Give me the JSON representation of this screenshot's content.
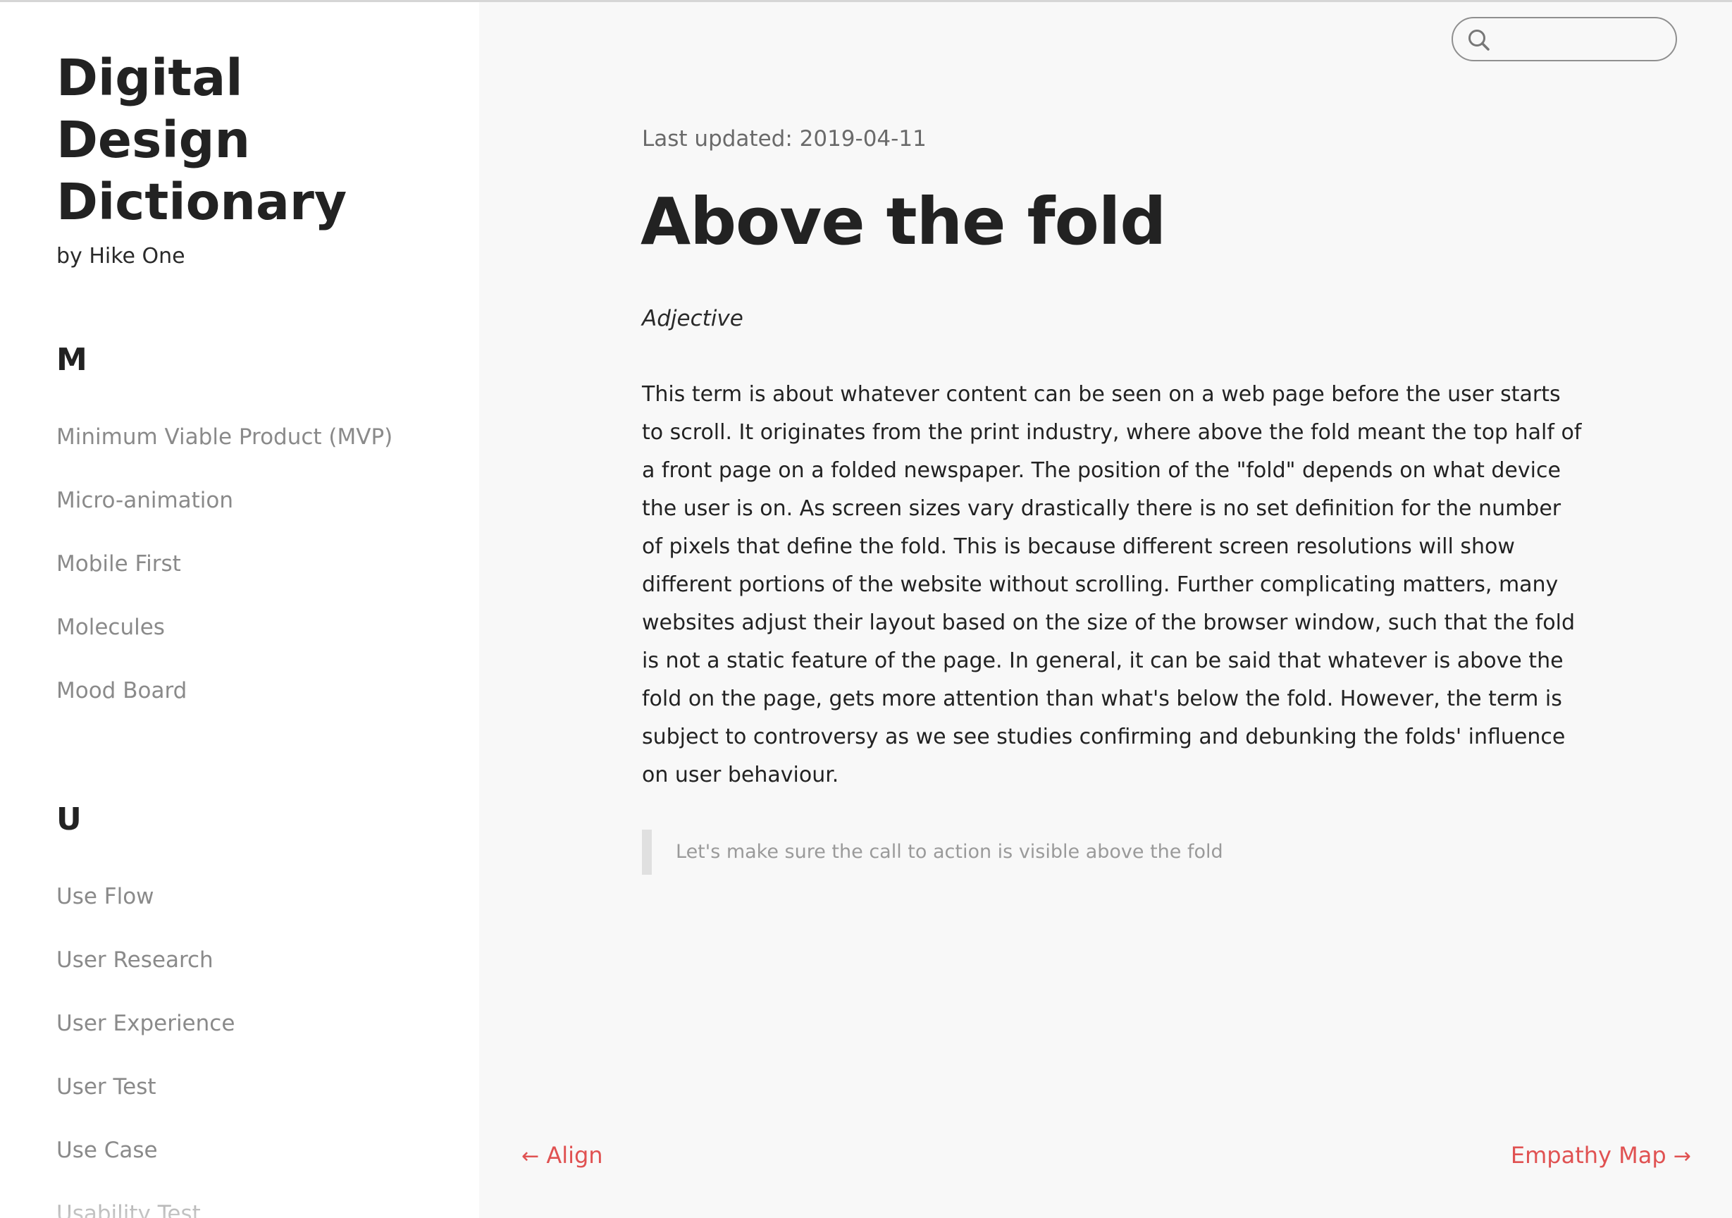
{
  "sidebar": {
    "title_line1": "Digital",
    "title_line2": "Design",
    "title_line3": "Dictionary",
    "byline": "by Hike One",
    "sections": [
      {
        "letter": "M",
        "items": [
          "Minimum Viable Product (MVP)",
          "Micro-animation",
          "Mobile First",
          "Molecules",
          "Mood Board"
        ]
      },
      {
        "letter": "U",
        "items": [
          "Use Flow",
          "User Research",
          "User Experience",
          "User Test",
          "Use Case",
          "Usability Test"
        ]
      }
    ]
  },
  "search": {
    "placeholder": "",
    "value": "",
    "icon": "search-icon"
  },
  "entry": {
    "last_updated": "Last updated: 2019-04-11",
    "title": "Above the fold",
    "word_class": "Adjective",
    "definition": "This term is about whatever content can be seen on a web page before the user starts to scroll. It originates from the print industry, where above the fold meant the top half of a front page on a folded newspaper. The position of the \"fold\" depends on what device the user is on. As screen sizes vary drastically there is no set definition for the number of pixels that define the fold. This is because different screen resolutions will show different portions of the website without scrolling. Further complicating matters, many websites adjust their layout based on the size of the browser window, such that the fold is not a static feature of the page. In general, it can be said that whatever is above the fold on the page, gets more attention than what's below the fold. However, the term is subject to controversy as we see studies confirming and debunking the folds' influence on user behaviour.",
    "example": "Let's make sure the call to action is visible above the fold"
  },
  "pagination": {
    "prev_arrow": "←",
    "prev_label": "Align",
    "next_label": "Empathy Map",
    "next_arrow": "→"
  },
  "colors": {
    "accent": "#e05252",
    "sidebar_bg": "#ffffff",
    "main_bg": "#f8f8f8",
    "muted_text": "#8a8a8a"
  }
}
